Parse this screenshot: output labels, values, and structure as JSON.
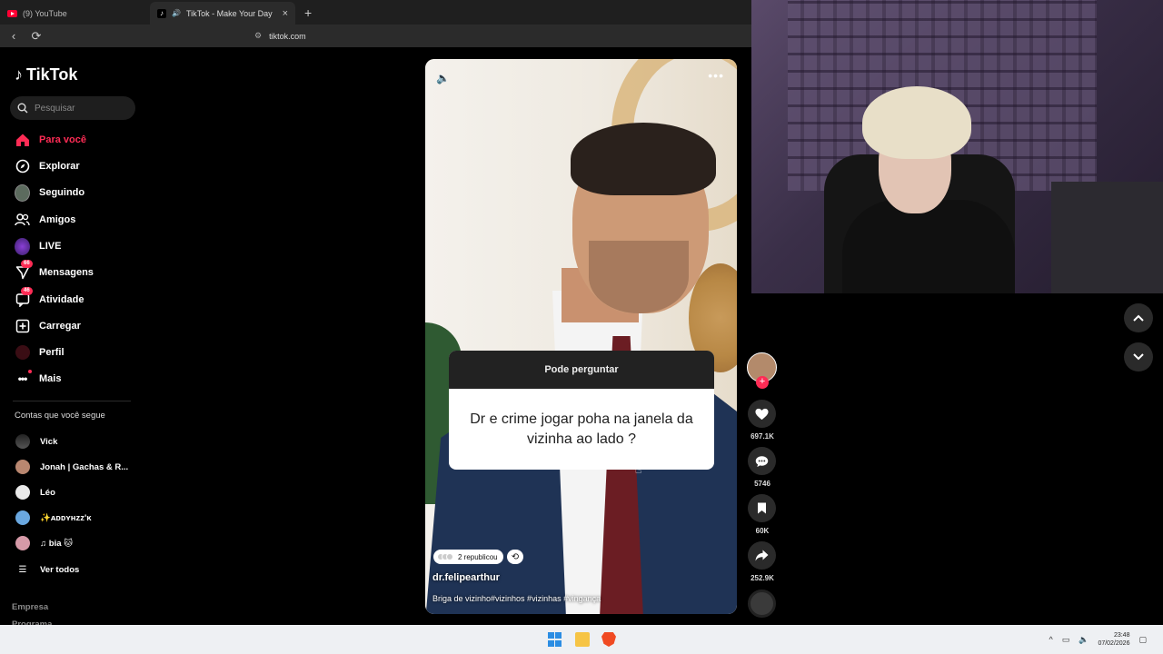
{
  "browser": {
    "tabs": [
      {
        "title": "(9) YouTube",
        "active": false
      },
      {
        "title": "TikTok - Make Your Day",
        "active": true
      }
    ],
    "new_tab": "+",
    "close_glyph": "×",
    "url": "tiktok.com"
  },
  "tiktok": {
    "logo_text": "TikTok",
    "search_placeholder": "Pesquisar",
    "nav": [
      {
        "label": "Para você",
        "icon": "home-icon",
        "active": true
      },
      {
        "label": "Explorar",
        "icon": "compass-icon"
      },
      {
        "label": "Seguindo",
        "icon": "following-avatar-icon"
      },
      {
        "label": "Amigos",
        "icon": "friends-icon"
      },
      {
        "label": "LIVE",
        "icon": "live-icon"
      },
      {
        "label": "Mensagens",
        "icon": "messages-icon",
        "badge": "66"
      },
      {
        "label": "Atividade",
        "icon": "activity-icon",
        "badge": "46"
      },
      {
        "label": "Carregar",
        "icon": "upload-icon"
      },
      {
        "label": "Perfil",
        "icon": "profile-icon"
      },
      {
        "label": "Mais",
        "icon": "more-icon"
      }
    ],
    "following_title": "Contas que você segue",
    "following": [
      {
        "name": "Vick"
      },
      {
        "name": "Jonah | Gachas & R..."
      },
      {
        "name": "Léo"
      },
      {
        "name": "✨ᴀᴅᴅʏʜᴢᴢ'ᴋ"
      },
      {
        "name": "♫ bia 🐱"
      }
    ],
    "see_all": "Ver todos",
    "footer": [
      "Empresa",
      "Programa"
    ]
  },
  "video": {
    "question_header": "Pode perguntar",
    "question_text": "Dr e crime jogar poha na janela da vizinha ao lado ?",
    "reposts": "2 republicou",
    "author": "dr.felipearthur",
    "caption": "Briga de vizinho#vizinhos #vizinhas #vingança",
    "more": "•••"
  },
  "actions": {
    "likes": "697.1K",
    "comments": "5746",
    "saves": "60K",
    "shares": "252.9K"
  },
  "taskbar": {
    "time": "23:48",
    "date": "07/02/2026"
  },
  "colors": {
    "accent": "#fe2c55",
    "background": "#000000"
  }
}
